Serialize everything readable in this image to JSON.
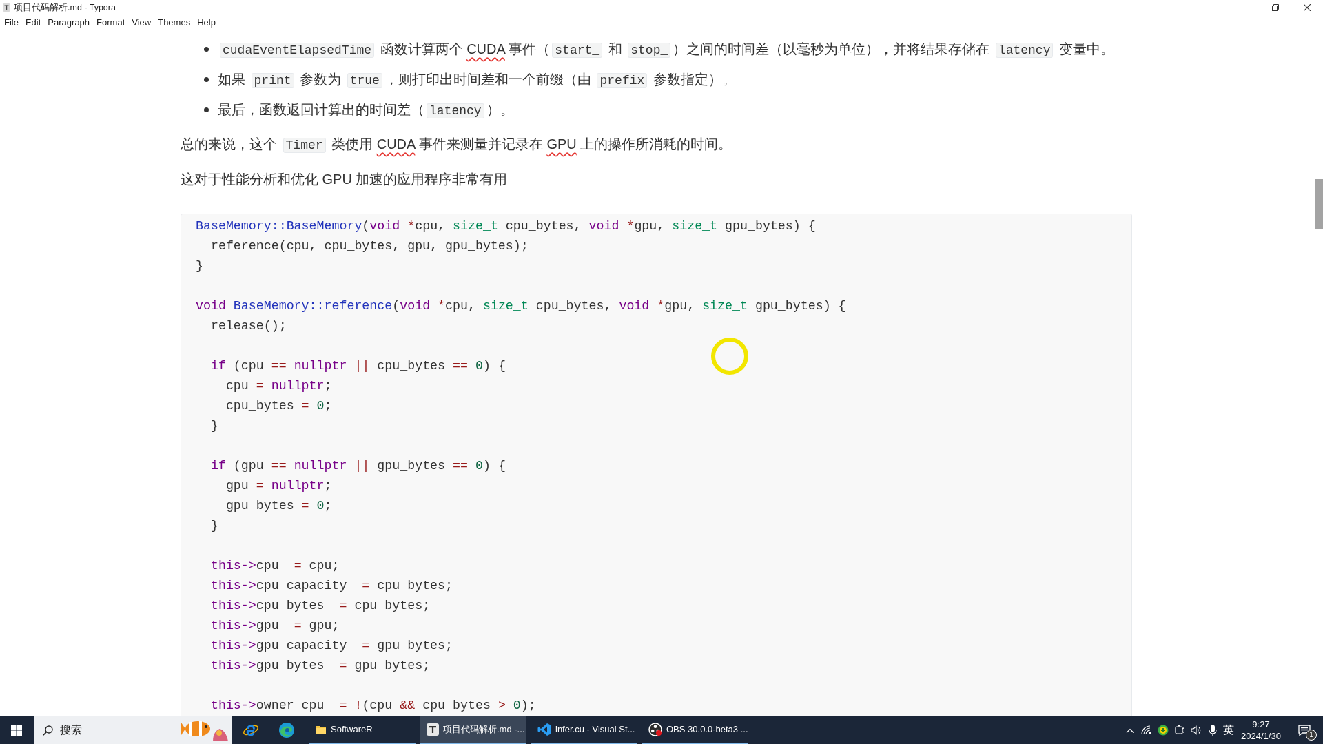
{
  "window": {
    "title": "项目代码解析.md - Typora"
  },
  "menu": [
    "File",
    "Edit",
    "Paragraph",
    "Format",
    "View",
    "Themes",
    "Help"
  ],
  "bullets": [
    {
      "segments": [
        {
          "text": "cudaEventElapsedTime",
          "kind": "code"
        },
        {
          "text": " 函数计算两个 ",
          "kind": "text"
        },
        {
          "text": "CUDA",
          "kind": "misspelled"
        },
        {
          "text": " 事件（",
          "kind": "text"
        },
        {
          "text": "start_",
          "kind": "code"
        },
        {
          "text": " 和 ",
          "kind": "text"
        },
        {
          "text": "stop_",
          "kind": "code"
        },
        {
          "text": "）之间的时间差（以毫秒为单位），并将结果存储在 ",
          "kind": "text"
        },
        {
          "text": "latency",
          "kind": "code"
        },
        {
          "text": " 变量中。",
          "kind": "text"
        }
      ]
    },
    {
      "segments": [
        {
          "text": "如果 ",
          "kind": "text"
        },
        {
          "text": "print",
          "kind": "code"
        },
        {
          "text": " 参数为 ",
          "kind": "text"
        },
        {
          "text": "true",
          "kind": "code"
        },
        {
          "text": "，则打印出时间差和一个前缀（由 ",
          "kind": "text"
        },
        {
          "text": "prefix",
          "kind": "code"
        },
        {
          "text": " 参数指定）。",
          "kind": "text"
        }
      ]
    },
    {
      "segments": [
        {
          "text": "最后，函数返回计算出的时间差（",
          "kind": "text"
        },
        {
          "text": "latency",
          "kind": "code"
        },
        {
          "text": "）。",
          "kind": "text"
        }
      ]
    }
  ],
  "paragraphs": [
    {
      "segments": [
        {
          "text": "总的来说，这个 ",
          "kind": "text"
        },
        {
          "text": "Timer",
          "kind": "code"
        },
        {
          "text": " 类使用 ",
          "kind": "text"
        },
        {
          "text": "CUDA",
          "kind": "misspelled"
        },
        {
          "text": " 事件来测量并记录在 ",
          "kind": "text"
        },
        {
          "text": "GPU",
          "kind": "misspelled"
        },
        {
          "text": " 上的操作所消耗的时间。",
          "kind": "text"
        }
      ]
    },
    {
      "segments": [
        {
          "text": "这对于性能分析和优化 GPU 加速的应用程序非常有用",
          "kind": "text"
        }
      ]
    }
  ],
  "code_block": {
    "groups": [
      {
        "lines": [
          {
            "tokens": [
              {
                "text": "BaseMemory::BaseMemory",
                "kind": "def"
              },
              {
                "text": "(",
                "kind": "plain"
              },
              {
                "text": "void",
                "kind": "keyword"
              },
              {
                "text": " *",
                "kind": "operator"
              },
              {
                "text": "cpu, ",
                "kind": "plain"
              },
              {
                "text": "size_t",
                "kind": "type"
              },
              {
                "text": " cpu_bytes, ",
                "kind": "plain"
              },
              {
                "text": "void",
                "kind": "keyword"
              },
              {
                "text": " *",
                "kind": "operator"
              },
              {
                "text": "gpu, ",
                "kind": "plain"
              },
              {
                "text": "size_t",
                "kind": "type"
              },
              {
                "text": " gpu_bytes) {",
                "kind": "plain"
              }
            ]
          },
          {
            "tokens": [
              {
                "text": "  reference(cpu, cpu_bytes, gpu, gpu_bytes);",
                "kind": "plain"
              }
            ]
          },
          {
            "tokens": [
              {
                "text": "}",
                "kind": "plain"
              }
            ]
          }
        ]
      },
      {
        "lines": [
          {
            "tokens": [
              {
                "text": "void ",
                "kind": "keyword"
              },
              {
                "text": "BaseMemory::reference",
                "kind": "def"
              },
              {
                "text": "(",
                "kind": "plain"
              },
              {
                "text": "void",
                "kind": "keyword"
              },
              {
                "text": " *",
                "kind": "operator"
              },
              {
                "text": "cpu, ",
                "kind": "plain"
              },
              {
                "text": "size_t",
                "kind": "type"
              },
              {
                "text": " cpu_bytes, ",
                "kind": "plain"
              },
              {
                "text": "void",
                "kind": "keyword"
              },
              {
                "text": " *",
                "kind": "operator"
              },
              {
                "text": "gpu, ",
                "kind": "plain"
              },
              {
                "text": "size_t",
                "kind": "type"
              },
              {
                "text": " gpu_bytes) {",
                "kind": "plain"
              }
            ]
          },
          {
            "tokens": [
              {
                "text": "  release();",
                "kind": "plain"
              }
            ]
          }
        ]
      },
      {
        "lines": [
          {
            "tokens": [
              {
                "text": "  if",
                "kind": "keyword"
              },
              {
                "text": " (cpu ",
                "kind": "plain"
              },
              {
                "text": "==",
                "kind": "operator"
              },
              {
                "text": " nullptr",
                "kind": "keyword"
              },
              {
                "text": " ||",
                "kind": "operator"
              },
              {
                "text": " cpu_bytes ",
                "kind": "plain"
              },
              {
                "text": "==",
                "kind": "operator"
              },
              {
                "text": " 0",
                "kind": "number"
              },
              {
                "text": ") {",
                "kind": "plain"
              }
            ]
          },
          {
            "tokens": [
              {
                "text": "    cpu ",
                "kind": "plain"
              },
              {
                "text": "=",
                "kind": "operator"
              },
              {
                "text": " nullptr",
                "kind": "keyword"
              },
              {
                "text": ";",
                "kind": "plain"
              }
            ]
          },
          {
            "tokens": [
              {
                "text": "    cpu_bytes ",
                "kind": "plain"
              },
              {
                "text": "=",
                "kind": "operator"
              },
              {
                "text": " 0",
                "kind": "number"
              },
              {
                "text": ";",
                "kind": "plain"
              }
            ]
          },
          {
            "tokens": [
              {
                "text": "  }",
                "kind": "plain"
              }
            ]
          }
        ]
      },
      {
        "lines": [
          {
            "tokens": [
              {
                "text": "  if",
                "kind": "keyword"
              },
              {
                "text": " (gpu ",
                "kind": "plain"
              },
              {
                "text": "==",
                "kind": "operator"
              },
              {
                "text": " nullptr",
                "kind": "keyword"
              },
              {
                "text": " ||",
                "kind": "operator"
              },
              {
                "text": " gpu_bytes ",
                "kind": "plain"
              },
              {
                "text": "==",
                "kind": "operator"
              },
              {
                "text": " 0",
                "kind": "number"
              },
              {
                "text": ") {",
                "kind": "plain"
              }
            ]
          },
          {
            "tokens": [
              {
                "text": "    gpu ",
                "kind": "plain"
              },
              {
                "text": "=",
                "kind": "operator"
              },
              {
                "text": " nullptr",
                "kind": "keyword"
              },
              {
                "text": ";",
                "kind": "plain"
              }
            ]
          },
          {
            "tokens": [
              {
                "text": "    gpu_bytes ",
                "kind": "plain"
              },
              {
                "text": "=",
                "kind": "operator"
              },
              {
                "text": " 0",
                "kind": "number"
              },
              {
                "text": ";",
                "kind": "plain"
              }
            ]
          },
          {
            "tokens": [
              {
                "text": "  }",
                "kind": "plain"
              }
            ]
          }
        ]
      },
      {
        "lines": [
          {
            "tokens": [
              {
                "text": "  this->",
                "kind": "keyword"
              },
              {
                "text": "cpu_ ",
                "kind": "plain"
              },
              {
                "text": "=",
                "kind": "operator"
              },
              {
                "text": " cpu;",
                "kind": "plain"
              }
            ]
          },
          {
            "tokens": [
              {
                "text": "  this->",
                "kind": "keyword"
              },
              {
                "text": "cpu_capacity_ ",
                "kind": "plain"
              },
              {
                "text": "=",
                "kind": "operator"
              },
              {
                "text": " cpu_bytes;",
                "kind": "plain"
              }
            ]
          },
          {
            "tokens": [
              {
                "text": "  this->",
                "kind": "keyword"
              },
              {
                "text": "cpu_bytes_ ",
                "kind": "plain"
              },
              {
                "text": "=",
                "kind": "operator"
              },
              {
                "text": " cpu_bytes;",
                "kind": "plain"
              }
            ]
          },
          {
            "tokens": [
              {
                "text": "  this->",
                "kind": "keyword"
              },
              {
                "text": "gpu_ ",
                "kind": "plain"
              },
              {
                "text": "=",
                "kind": "operator"
              },
              {
                "text": " gpu;",
                "kind": "plain"
              }
            ]
          },
          {
            "tokens": [
              {
                "text": "  this->",
                "kind": "keyword"
              },
              {
                "text": "gpu_capacity_ ",
                "kind": "plain"
              },
              {
                "text": "=",
                "kind": "operator"
              },
              {
                "text": " gpu_bytes;",
                "kind": "plain"
              }
            ]
          },
          {
            "tokens": [
              {
                "text": "  this->",
                "kind": "keyword"
              },
              {
                "text": "gpu_bytes_ ",
                "kind": "plain"
              },
              {
                "text": "=",
                "kind": "operator"
              },
              {
                "text": " gpu_bytes;",
                "kind": "plain"
              }
            ]
          }
        ]
      },
      {
        "lines": [
          {
            "tokens": [
              {
                "text": "  this->",
                "kind": "keyword"
              },
              {
                "text": "owner_cpu_ ",
                "kind": "plain"
              },
              {
                "text": "= !",
                "kind": "operator"
              },
              {
                "text": "(cpu ",
                "kind": "plain"
              },
              {
                "text": "&&",
                "kind": "operator"
              },
              {
                "text": " cpu_bytes ",
                "kind": "plain"
              },
              {
                "text": ">",
                "kind": "operator"
              },
              {
                "text": " 0",
                "kind": "number"
              },
              {
                "text": ");",
                "kind": "plain"
              }
            ]
          }
        ]
      }
    ]
  },
  "taskbar": {
    "search": {
      "placeholder": "搜索"
    },
    "apps": [
      {
        "label": "SoftwareR",
        "kind": "folder",
        "selected": false
      },
      {
        "label": "项目代码解析.md -...",
        "kind": "typora",
        "selected": true
      },
      {
        "label": "infer.cu - Visual St...",
        "kind": "vscode",
        "selected": false
      },
      {
        "label": "OBS 30.0.0-beta3 ...",
        "kind": "obs",
        "selected": false
      }
    ],
    "tray": {
      "language": "英",
      "time": "9:27",
      "date": "2024/1/30",
      "notifications": "1"
    }
  }
}
